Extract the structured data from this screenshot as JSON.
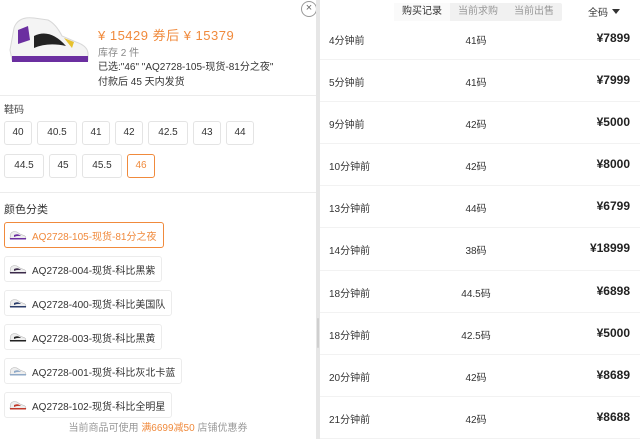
{
  "product": {
    "price_text": "¥ 15429 券后 ¥ 15379",
    "stock": "库存 2 件",
    "selected": "已选:\"46\" \"AQ2728-105-现货-81分之夜\"",
    "shipping": "付款后 45 天内发货",
    "close_label": "×"
  },
  "size_section": {
    "label": "鞋码",
    "rows": [
      [
        "40",
        "40.5",
        "41",
        "42",
        "42.5",
        "43",
        "44"
      ],
      [
        "44.5",
        "45",
        "45.5",
        "46"
      ]
    ],
    "selected": "46"
  },
  "color_section": {
    "label": "颜色分类",
    "items": [
      {
        "label": "AQ2728-105-现货-81分之夜",
        "selected": true,
        "color": "#6b2fa0"
      },
      {
        "label": "AQ2728-004-现货-科比黑紫",
        "selected": false,
        "color": "#3b2a4a"
      },
      {
        "label": "AQ2728-400-现货-科比美国队",
        "selected": false,
        "color": "#2c3e6b"
      },
      {
        "label": "AQ2728-003-现货-科比黑黄",
        "selected": false,
        "color": "#222222"
      },
      {
        "label": "AQ2728-001-现货-科比灰北卡蓝",
        "selected": false,
        "color": "#8fa9c7"
      },
      {
        "label": "AQ2728-102-现货-科比全明星",
        "selected": false,
        "color": "#c0392b"
      }
    ]
  },
  "coupon": {
    "prefix": "当前商品可使用",
    "highlight": "满6699减50",
    "suffix": "店铺优惠券"
  },
  "tabs": [
    {
      "label": "购买记录",
      "active": true
    },
    {
      "label": "当前求购",
      "active": false
    },
    {
      "label": "当前出售",
      "active": false
    }
  ],
  "size_filter": {
    "label": "全码"
  },
  "records": [
    {
      "time": "4分钟前",
      "size": "41码",
      "price": "¥7899"
    },
    {
      "time": "5分钟前",
      "size": "41码",
      "price": "¥7999"
    },
    {
      "time": "9分钟前",
      "size": "42码",
      "price": "¥5000"
    },
    {
      "time": "10分钟前",
      "size": "42码",
      "price": "¥8000"
    },
    {
      "time": "13分钟前",
      "size": "44码",
      "price": "¥6799"
    },
    {
      "time": "14分钟前",
      "size": "38码",
      "price": "¥18999"
    },
    {
      "time": "18分钟前",
      "size": "44.5码",
      "price": "¥6898"
    },
    {
      "time": "18分钟前",
      "size": "42.5码",
      "price": "¥5000"
    },
    {
      "time": "20分钟前",
      "size": "42码",
      "price": "¥8689"
    },
    {
      "time": "21分钟前",
      "size": "42码",
      "price": "¥8688"
    }
  ],
  "colors": {
    "accent": "#f08a3c",
    "text": "#333333",
    "muted": "#999999"
  }
}
